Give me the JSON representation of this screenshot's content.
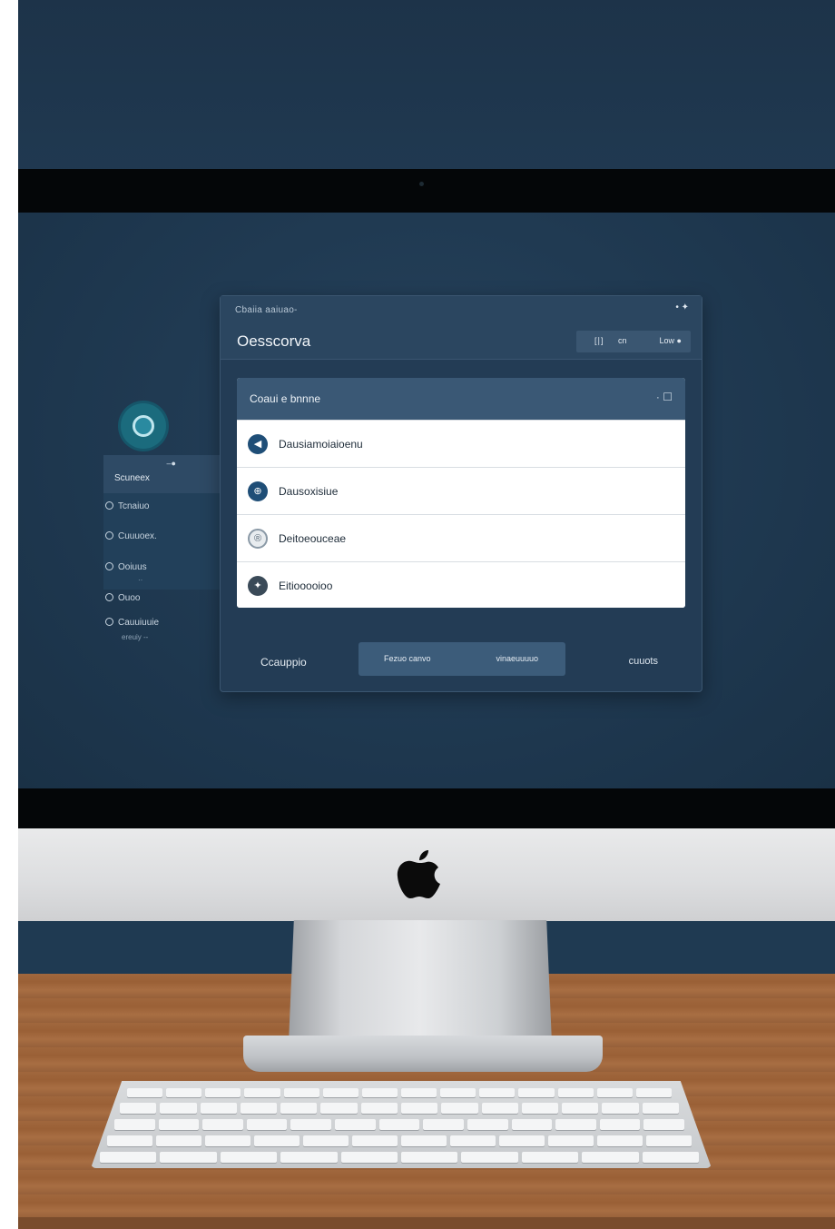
{
  "dialog": {
    "small_title": "Cbaiia aaiuao-",
    "top_icons": "• ✦",
    "title": "Oesscorva",
    "pills": {
      "a": "[∣]",
      "b": "cn",
      "c": "Low ●"
    },
    "list_title": "Coaui e bnnne",
    "list_header_icons": "· ☐",
    "items": [
      {
        "icon": "◀",
        "label": "Dausiamoiaioenu"
      },
      {
        "icon": "⊕",
        "label": "Dausoxisiue"
      },
      {
        "icon": "®",
        "label": "Deitoeouceae"
      },
      {
        "icon": "✦",
        "label": "Eitiooooioo"
      }
    ],
    "footer_left": "Ccauppio",
    "footer_center_a": "Fezuo canvo",
    "footer_center_b": "vinaeuuuuo",
    "footer_right": "cuuots"
  },
  "sidebar": {
    "active_mark": "–●",
    "active_label": "Scuneex",
    "items": [
      {
        "label": "Tcnaiuo"
      },
      {
        "label": "Cuuuoex."
      },
      {
        "label": "Ooiuus"
      },
      {
        "label": "Ouoo"
      },
      {
        "label": "Cauuiuuie"
      }
    ],
    "sub_a": "··",
    "sub_b": "ereuiy --"
  }
}
